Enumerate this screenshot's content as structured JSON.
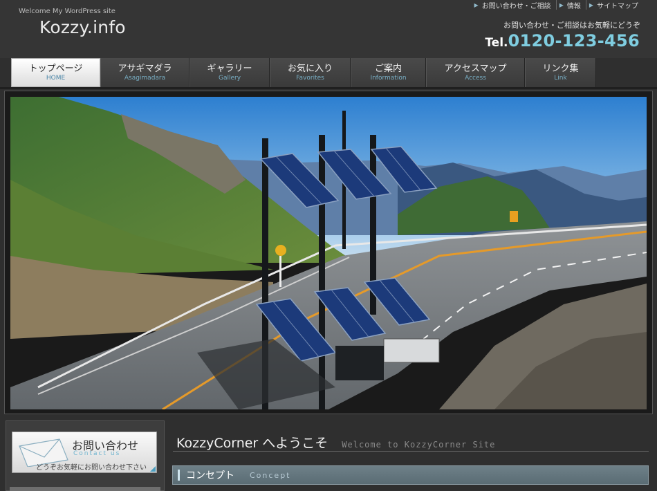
{
  "site": {
    "tagline": "Welcome My WordPress site",
    "logo": "Kozzy.info"
  },
  "utility_links": [
    {
      "label": "お問い合わせ・ご相談"
    },
    {
      "label": "情報"
    },
    {
      "label": "サイトマップ"
    }
  ],
  "contact": {
    "message": "お問い合わせ・ご相談はお気軽にどうぞ",
    "tel_prefix": "Tel.",
    "tel_number": "0120-123-456"
  },
  "nav": [
    {
      "jp": "トップページ",
      "en": "HOME",
      "active": true
    },
    {
      "jp": "アサギマダラ",
      "en": "Asagimadara"
    },
    {
      "jp": "ギャラリー",
      "en": "Gallery"
    },
    {
      "jp": "お気に入り",
      "en": "Favorites"
    },
    {
      "jp": "ご案内",
      "en": "Information"
    },
    {
      "jp": "アクセスマップ",
      "en": "Access"
    },
    {
      "jp": "リンク集",
      "en": "Link"
    }
  ],
  "sidebar": {
    "contact_banner": {
      "title": "お問い合わせ",
      "subtitle": "Contact us",
      "message": "どうぞお気軽にお問い合わせ下さい"
    }
  },
  "main": {
    "welcome_jp": "KozzyCorner へようこそ",
    "welcome_en": "Welcome to KozzyCorner Site",
    "section_jp": "コンセプト",
    "section_en": "Concept"
  },
  "colors": {
    "accent": "#7fcde0",
    "nav_en": "#78aec4",
    "background": "#2f2f2f"
  }
}
